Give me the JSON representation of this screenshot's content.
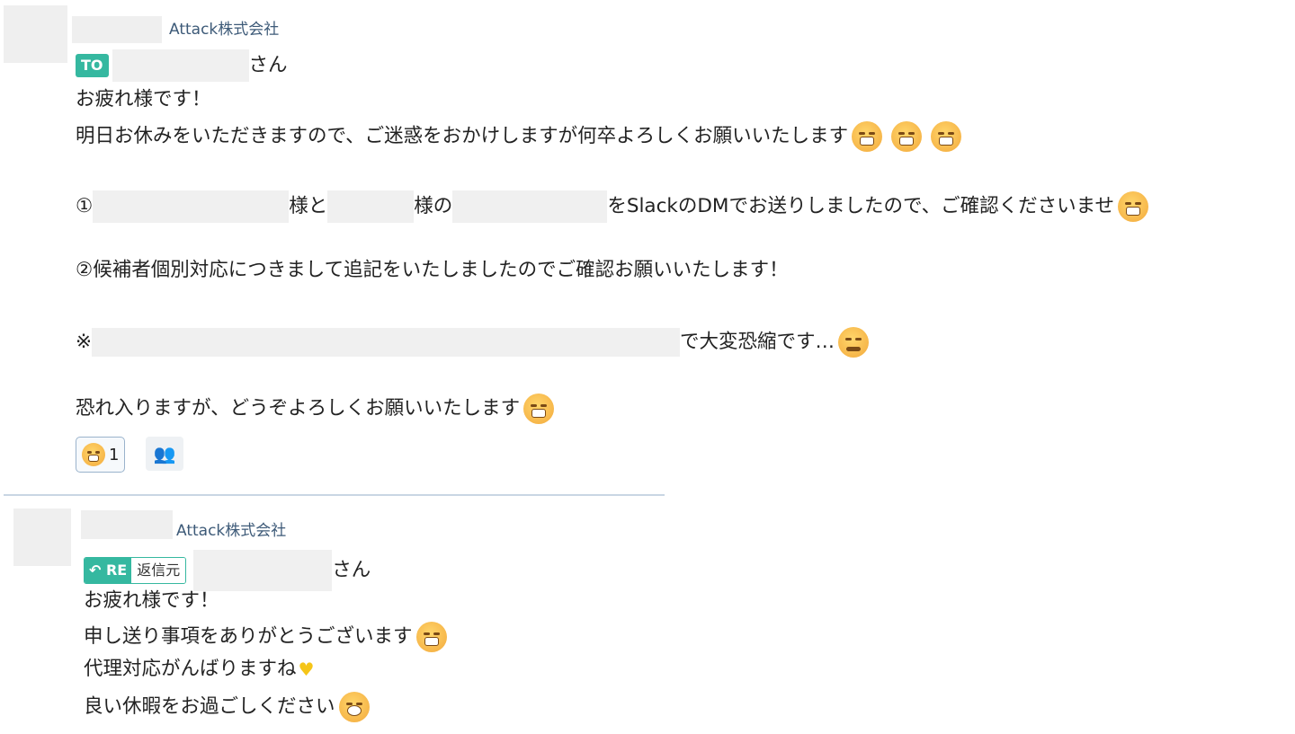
{
  "message1": {
    "company": "Attack株式会社",
    "to_tag": "TO",
    "to_suffix": "さん",
    "greeting": "お疲れ様です！",
    "line1": "明日お休みをいただきますので、ご迷惑をおかけしますが何卒よろしくお願いいたします",
    "line2_prefix": "①",
    "line2_mid1": "様と",
    "line2_mid2": "様の",
    "line2_suffix": "をSlackのDMでお送りしましたので、ご確認くださいませ",
    "line3": "②候補者個別対応につきまして追記をいたしましたのでご確認お願いいたします！",
    "line4_prefix": "※",
    "line4_suffix": "で大変恐縮です…",
    "closing": "恐れ入りますが、どうぞよろしくお願いいたします",
    "reaction_count": "1",
    "reader_icon": "readers-list-icon"
  },
  "message2": {
    "company": "Attack株式会社",
    "re_tag": "RE",
    "re_source": "返信元",
    "to_suffix": "さん",
    "greeting": "お疲れ様です！",
    "line1": "申し送り事項をありがとうございます",
    "line2": "代理対応がんばりますね",
    "line3": "良い休暇をお過ごしください"
  },
  "colors": {
    "accent": "#35b8a0",
    "company_text": "#3d5a78",
    "divider": "#c9d6e3"
  }
}
